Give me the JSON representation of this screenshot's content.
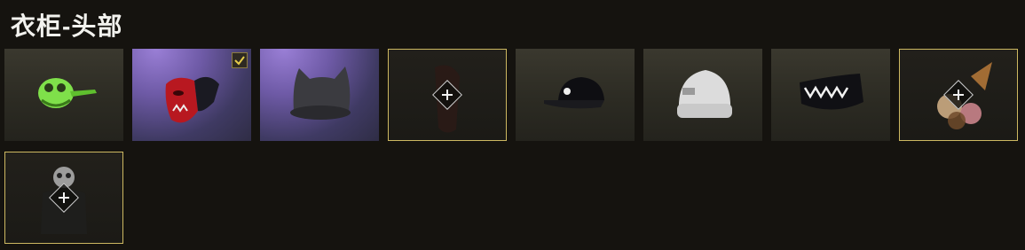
{
  "header": {
    "title": "衣柜-头部"
  },
  "items": [
    {
      "name": "green-animal-mask",
      "state": "owned"
    },
    {
      "name": "red-oni-mask",
      "state": "equipped"
    },
    {
      "name": "gray-cat-ear-beanie",
      "state": "owned"
    },
    {
      "name": "dark-hair-item",
      "state": "locked"
    },
    {
      "name": "black-baseball-cap",
      "state": "owned"
    },
    {
      "name": "white-knit-beanie",
      "state": "owned"
    },
    {
      "name": "shark-teeth-face-mask",
      "state": "owned"
    },
    {
      "name": "ice-cream-cone-hat",
      "state": "locked"
    },
    {
      "name": "panda-head",
      "state": "locked"
    }
  ],
  "colors": {
    "locked_border": "#cdb861",
    "background": "#15130f"
  }
}
